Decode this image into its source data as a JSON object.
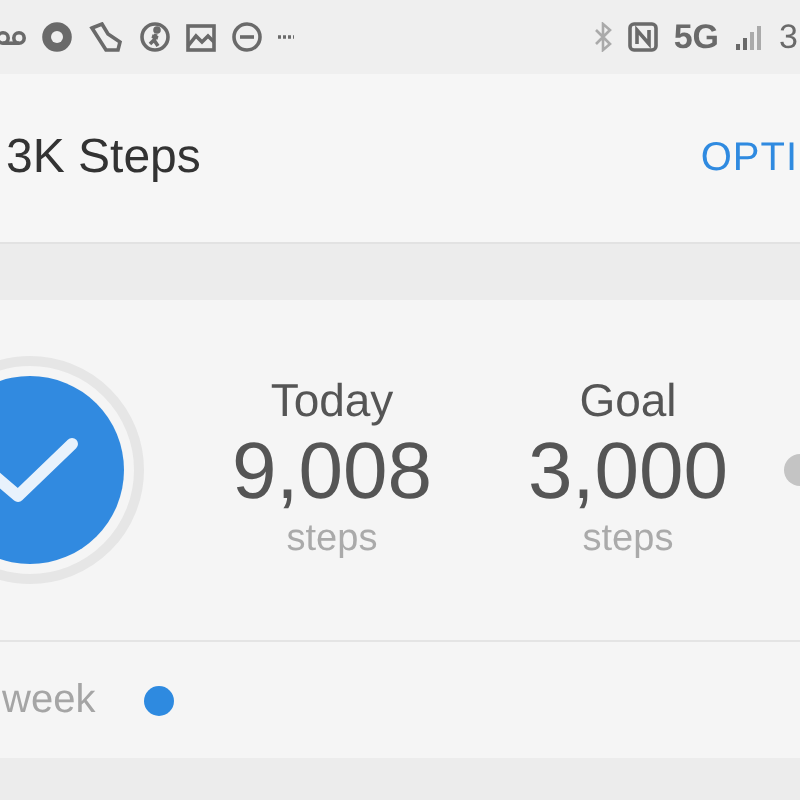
{
  "status_bar": {
    "network": "5G",
    "battery": "3"
  },
  "app_bar": {
    "title": "3K Steps",
    "action": "OPTI"
  },
  "summary": {
    "completed": true,
    "stats": [
      {
        "label": "Today",
        "value": "9,008",
        "unit": "steps"
      },
      {
        "label": "Goal",
        "value": "3,000",
        "unit": "steps"
      }
    ]
  },
  "week": {
    "label": "week",
    "dots": [
      {
        "color": "#2e8ae0"
      }
    ]
  }
}
